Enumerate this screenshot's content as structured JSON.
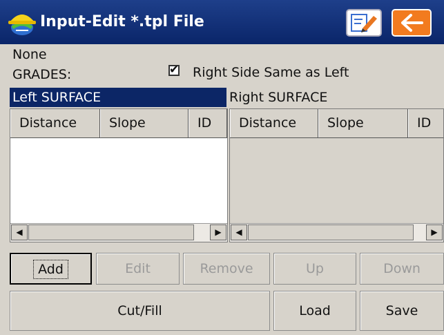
{
  "window": {
    "title": "Input-Edit *.tpl File",
    "icons": {
      "app": "hardhat-globe-icon",
      "edit": "pencil-edit-icon",
      "back": "arrow-left-icon"
    },
    "colors": {
      "titlebar": "#0a2569",
      "back_button": "#f27b1f",
      "selection": "#0c2666"
    }
  },
  "info": {
    "file_name": "None",
    "grades_label": "GRADES:",
    "right_same_label": "Right Side Same as Left",
    "right_same_checked": true,
    "checkmark": "✔"
  },
  "left": {
    "surface_label": "Left SURFACE",
    "columns": [
      "Distance",
      "Slope",
      "ID"
    ],
    "rows": []
  },
  "right": {
    "surface_label": "Right SURFACE",
    "columns": [
      "Distance",
      "Slope",
      "ID"
    ],
    "rows": []
  },
  "scroll": {
    "left_arrow": "◀",
    "right_arrow": "▶"
  },
  "buttons": {
    "add": "Add",
    "edit": "Edit",
    "remove": "Remove",
    "up": "Up",
    "down": "Down",
    "cut_fill": "Cut/Fill",
    "load": "Load",
    "save": "Save"
  }
}
